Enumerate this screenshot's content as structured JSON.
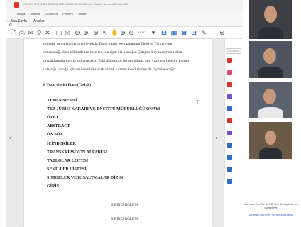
{
  "window": {
    "title": "KURUM TEZ_2021 SÜREÇ TEZ YAZIM KILAVUZU.pdf - Adobe Acrobat Reader DC"
  },
  "menu": [
    "Dosya",
    "Düzenle",
    "Görünüm",
    "Pencere",
    "Yardım"
  ],
  "tabs": {
    "home": "Ana Sayfa",
    "tools": "Araçlar",
    "doc": "KU..."
  },
  "toolbar": {
    "page_indicator": "1 / 57"
  },
  "right_pane": {
    "search_placeholder": "Araçlarda ara",
    "tool_colors": [
      "#d9342b",
      "#e0457b",
      "#d9342b",
      "#7a4cc4",
      "#2b6cc4",
      "#d9342b",
      "#7a4cc4",
      "#2b6cc4",
      "#2b6cc4",
      "#2b6cc4",
      "#2b6cc4"
    ]
  },
  "document": {
    "paragraph_lines": [
      "altbaslar tanımlanmıyor edilecektir. Dahil yazılı esen tanımına Türkiye Türkiye'nin",
      "olmamasığı. Son bölümde tez esen ise yazlığım ala olacağır. Çalışma boyunca yazılı olan",
      "kaynaklarından atıfta kullanacağız. Tabi daha önce bahsettiğimiz gibi yazımda iletişim kurma",
      "kolaylığı olduğu için en önemli kaynak olarak yazarın kendisinden da faydalanacağız."
    ],
    "section_heading": "4. Tezin Geçici Planı (Taslak)",
    "toc_items": [
      "YEMİN METNİ",
      "TEZ JÜRİSİ KARARI VE ENSTİTÜ MÜDÜRLÜĞÜ ONAYI",
      "ÖZET",
      "ABSTRACT",
      "ÖN SÖZ",
      "İÇİNDEKİLER",
      "TRANSKRİPSİYON ALFABESİ",
      "TABLOLAR LİSTESİ",
      "ŞEKİLLER LİSTESİ",
      "SİMGELER VE KISALTMALAR DİZİNİ",
      "GİRİŞ"
    ],
    "chapter_labels": [
      "BİRİNCİ BÖLÜM",
      "BİRİNCİ BÖLÜM"
    ]
  },
  "promo": {
    "text": "Acrobat Pro DC ile PDF'leri dönüştürün ve düzenleyin",
    "link": "Ücretsiz Deneme Sürümünü Başlat"
  },
  "participants": {
    "colors": {
      "video_bg_1": "#3d3f44",
      "video_bg_2": "#4e5560",
      "video_bg_3": "#5a6270",
      "video_bg_4": "#6b5a48",
      "skin": "#c8987a",
      "shirt": "#2b2f38",
      "white_shirt": "#e8e8e8"
    }
  }
}
